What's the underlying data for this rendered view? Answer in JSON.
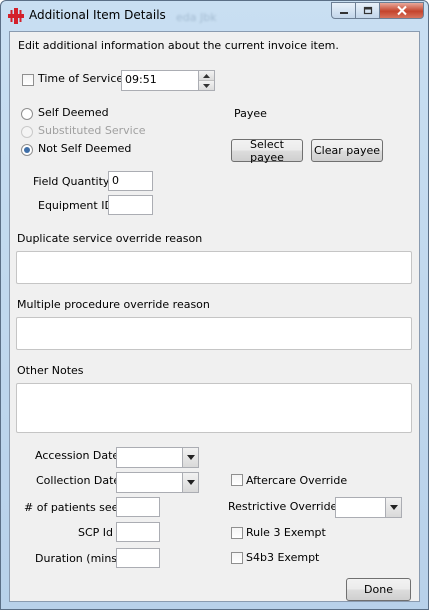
{
  "window": {
    "title": "Additional Item Details",
    "background_title_text": "eda Jbk"
  },
  "form": {
    "intro": "Edit additional information about the current invoice item.",
    "time_of_service": {
      "label": "Time of Service",
      "checked": false,
      "value": "09:51"
    },
    "deemed": {
      "options": [
        {
          "label": "Self Deemed",
          "checked": false,
          "enabled": true
        },
        {
          "label": "Substituted Service",
          "checked": false,
          "enabled": false
        },
        {
          "label": "Not Self Deemed",
          "checked": true,
          "enabled": true
        }
      ]
    },
    "payee": {
      "label": "Payee",
      "select_label": "Select payee",
      "clear_label": "Clear payee"
    },
    "field_quantity": {
      "label": "Field Quantity",
      "value": "0"
    },
    "equipment_id": {
      "label": "Equipment ID",
      "value": ""
    },
    "duplicate_reason": {
      "label": "Duplicate service override reason",
      "value": ""
    },
    "multiple_reason": {
      "label": "Multiple procedure override reason",
      "value": ""
    },
    "other_notes": {
      "label": "Other Notes",
      "value": ""
    },
    "accession_date": {
      "label": "Accession Date",
      "value": ""
    },
    "collection_date": {
      "label": "Collection Date",
      "value": ""
    },
    "patients_seen": {
      "label": "# of patients seen",
      "value": ""
    },
    "scp_id": {
      "label": "SCP Id",
      "value": ""
    },
    "duration": {
      "label": "Duration (mins)",
      "value": ""
    },
    "aftercare_override": {
      "label": "Aftercare Override",
      "checked": false
    },
    "restrictive_override": {
      "label": "Restrictive Override",
      "value": ""
    },
    "rule3_exempt": {
      "label": "Rule 3 Exempt",
      "checked": false
    },
    "s4b3_exempt": {
      "label": "S4b3 Exempt",
      "checked": false
    },
    "done_label": "Done"
  },
  "icons": {
    "app": "red-cross-icon",
    "minimize": "minimize-icon",
    "maximize": "maximize-icon",
    "close": "close-icon",
    "dropdown": "chevron-down-icon",
    "spin_up": "spin-up-icon",
    "spin_down": "spin-down-icon"
  },
  "colors": {
    "title_bar": "#c9dff2",
    "client_bg": "#f0f0f0",
    "close_button": "#c4442d",
    "radio_dot": "#3f6fa8"
  }
}
